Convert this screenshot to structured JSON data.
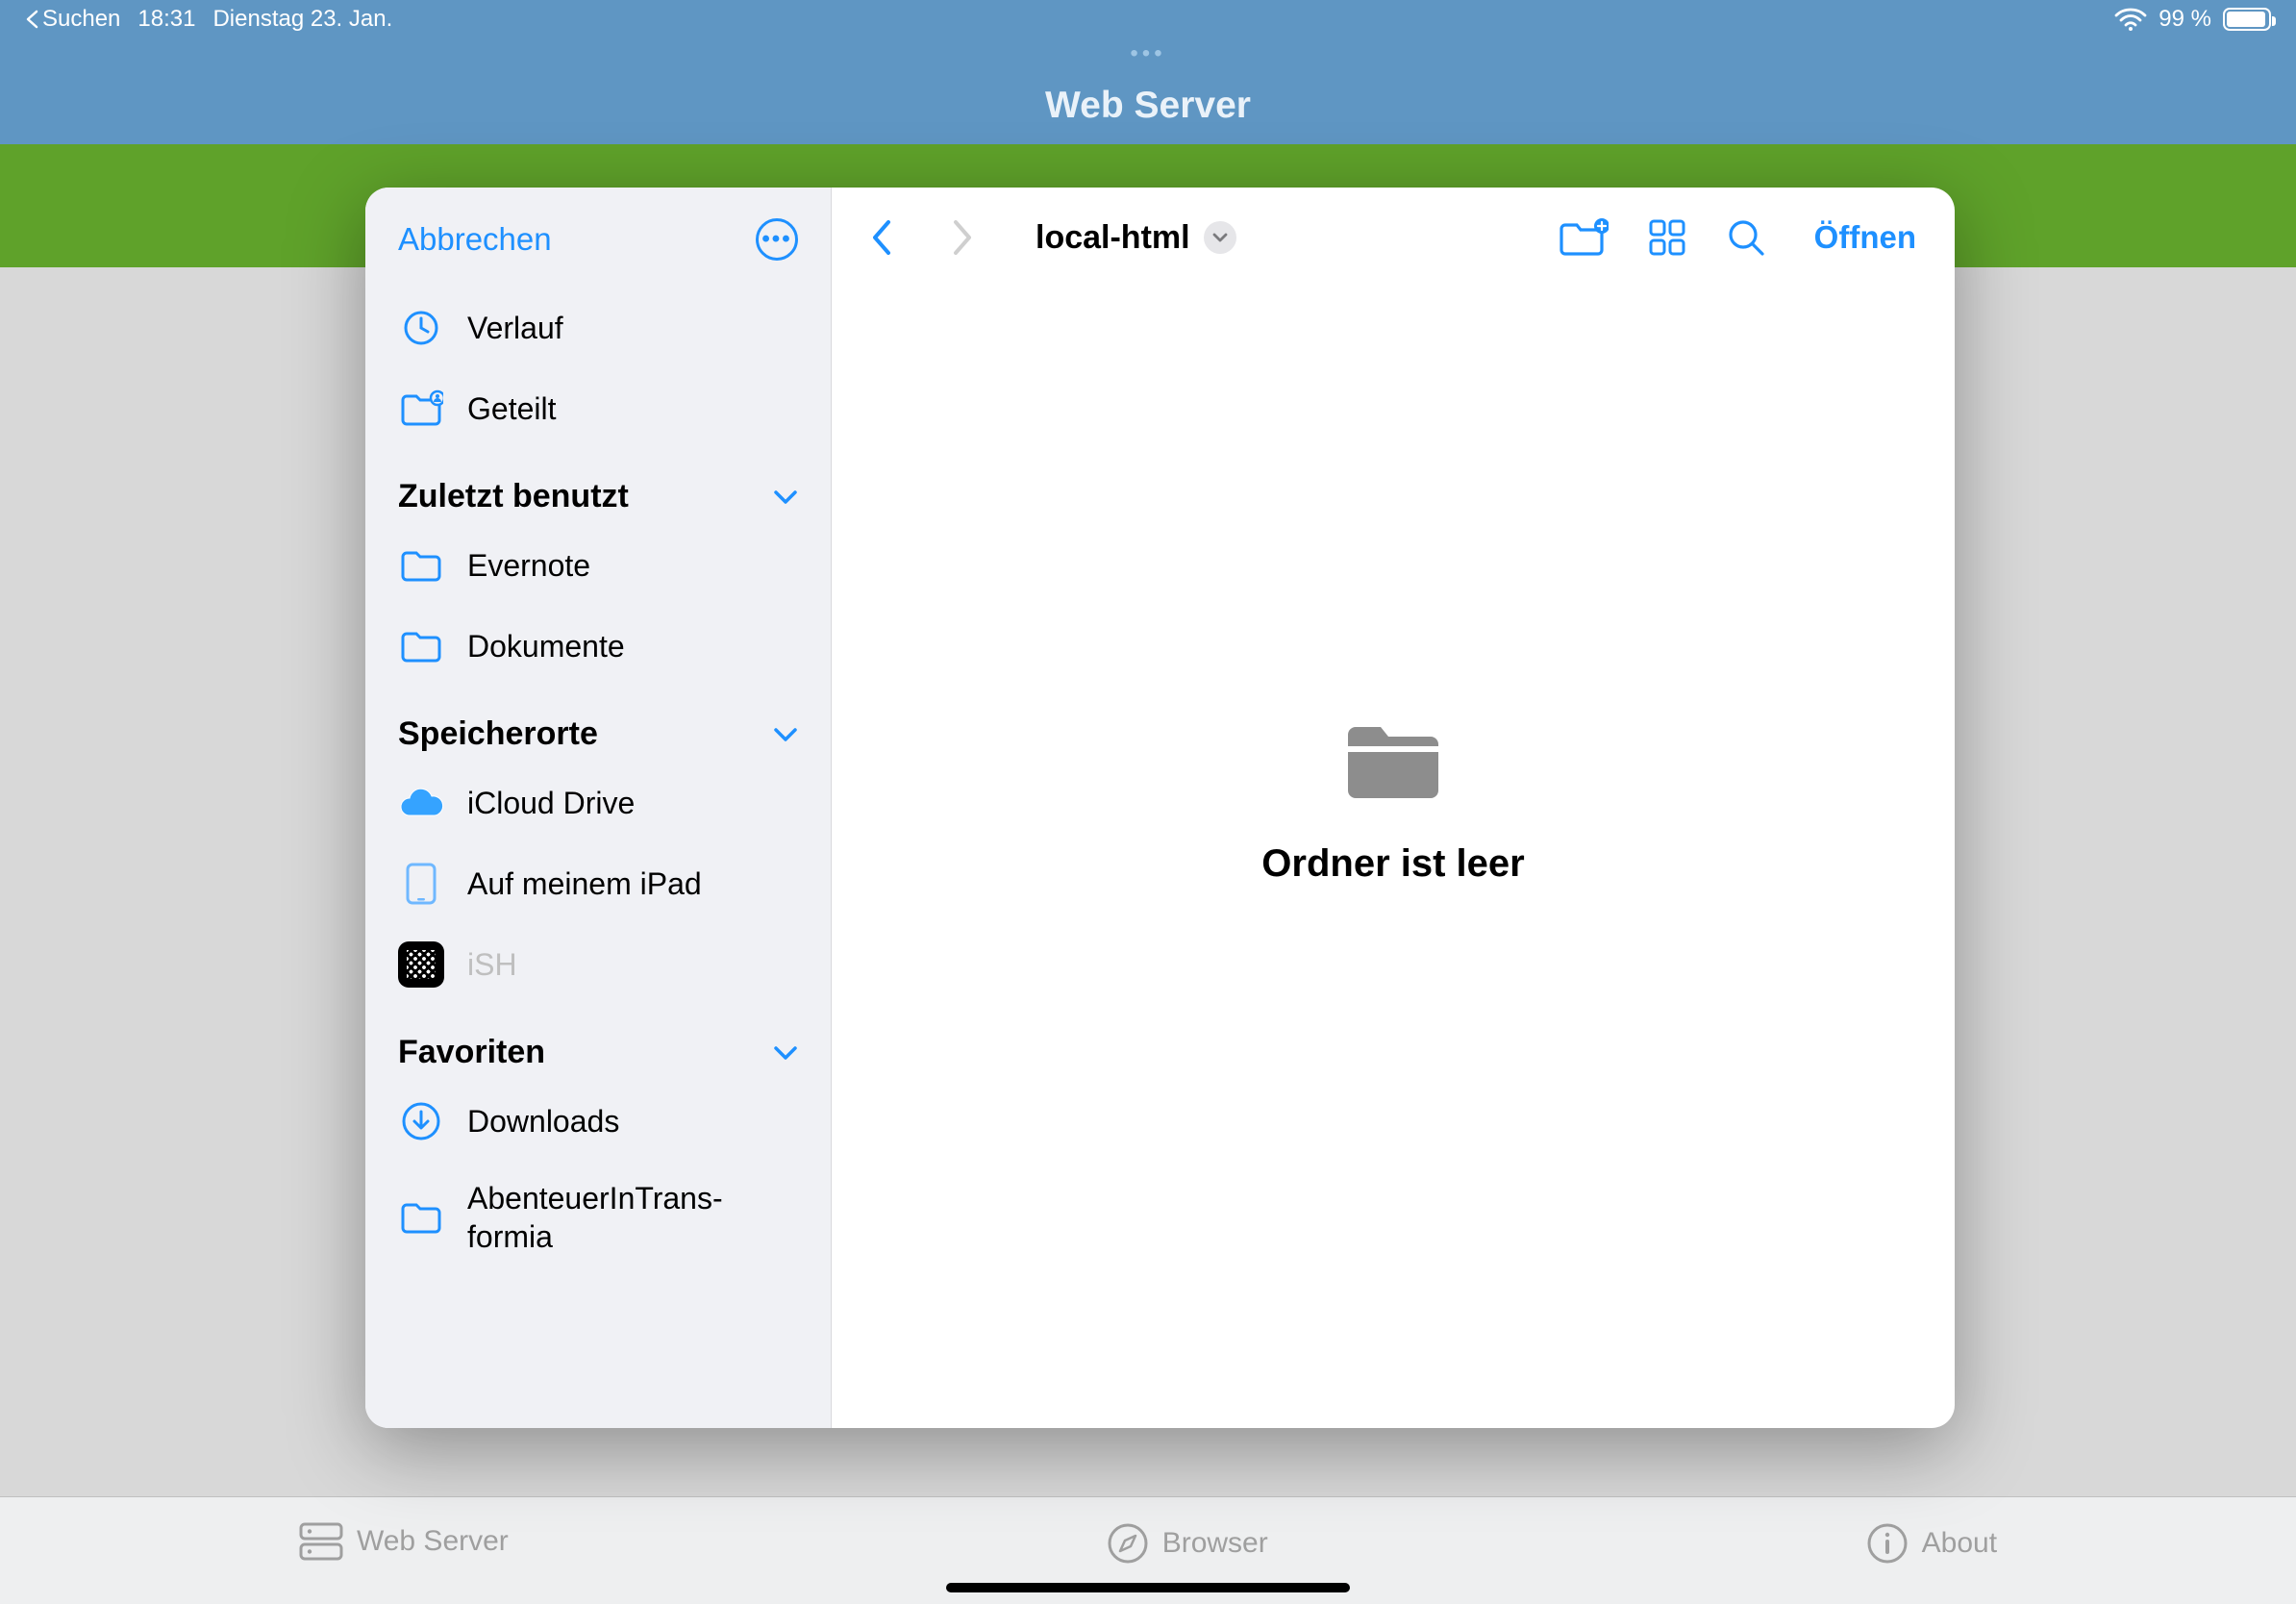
{
  "status_bar": {
    "back_app": "Suchen",
    "time": "18:31",
    "date": "Dienstag 23. Jan.",
    "battery_percent": "99 %"
  },
  "app_header": {
    "title": "Web Server"
  },
  "picker": {
    "cancel": "Abbrechen",
    "open": "Öffnen",
    "breadcrumb": "local-html",
    "empty_message": "Ordner ist leer",
    "quick_items": [
      {
        "label": "Verlauf"
      },
      {
        "label": "Geteilt"
      }
    ],
    "sections": [
      {
        "title": "Zuletzt benutzt",
        "items": [
          {
            "label": "Evernote"
          },
          {
            "label": "Dokumente"
          }
        ]
      },
      {
        "title": "Speicherorte",
        "items": [
          {
            "label": "iCloud Drive"
          },
          {
            "label": "Auf meinem iPad"
          },
          {
            "label": "iSH",
            "dimmed": true
          }
        ]
      },
      {
        "title": "Favoriten",
        "items": [
          {
            "label": "Downloads"
          },
          {
            "label": "AbenteuerInTrans-\nformia"
          }
        ]
      }
    ]
  },
  "bottom_bar": {
    "tabs": [
      {
        "label": "Web Server"
      },
      {
        "label": "Browser"
      },
      {
        "label": "About"
      }
    ]
  }
}
